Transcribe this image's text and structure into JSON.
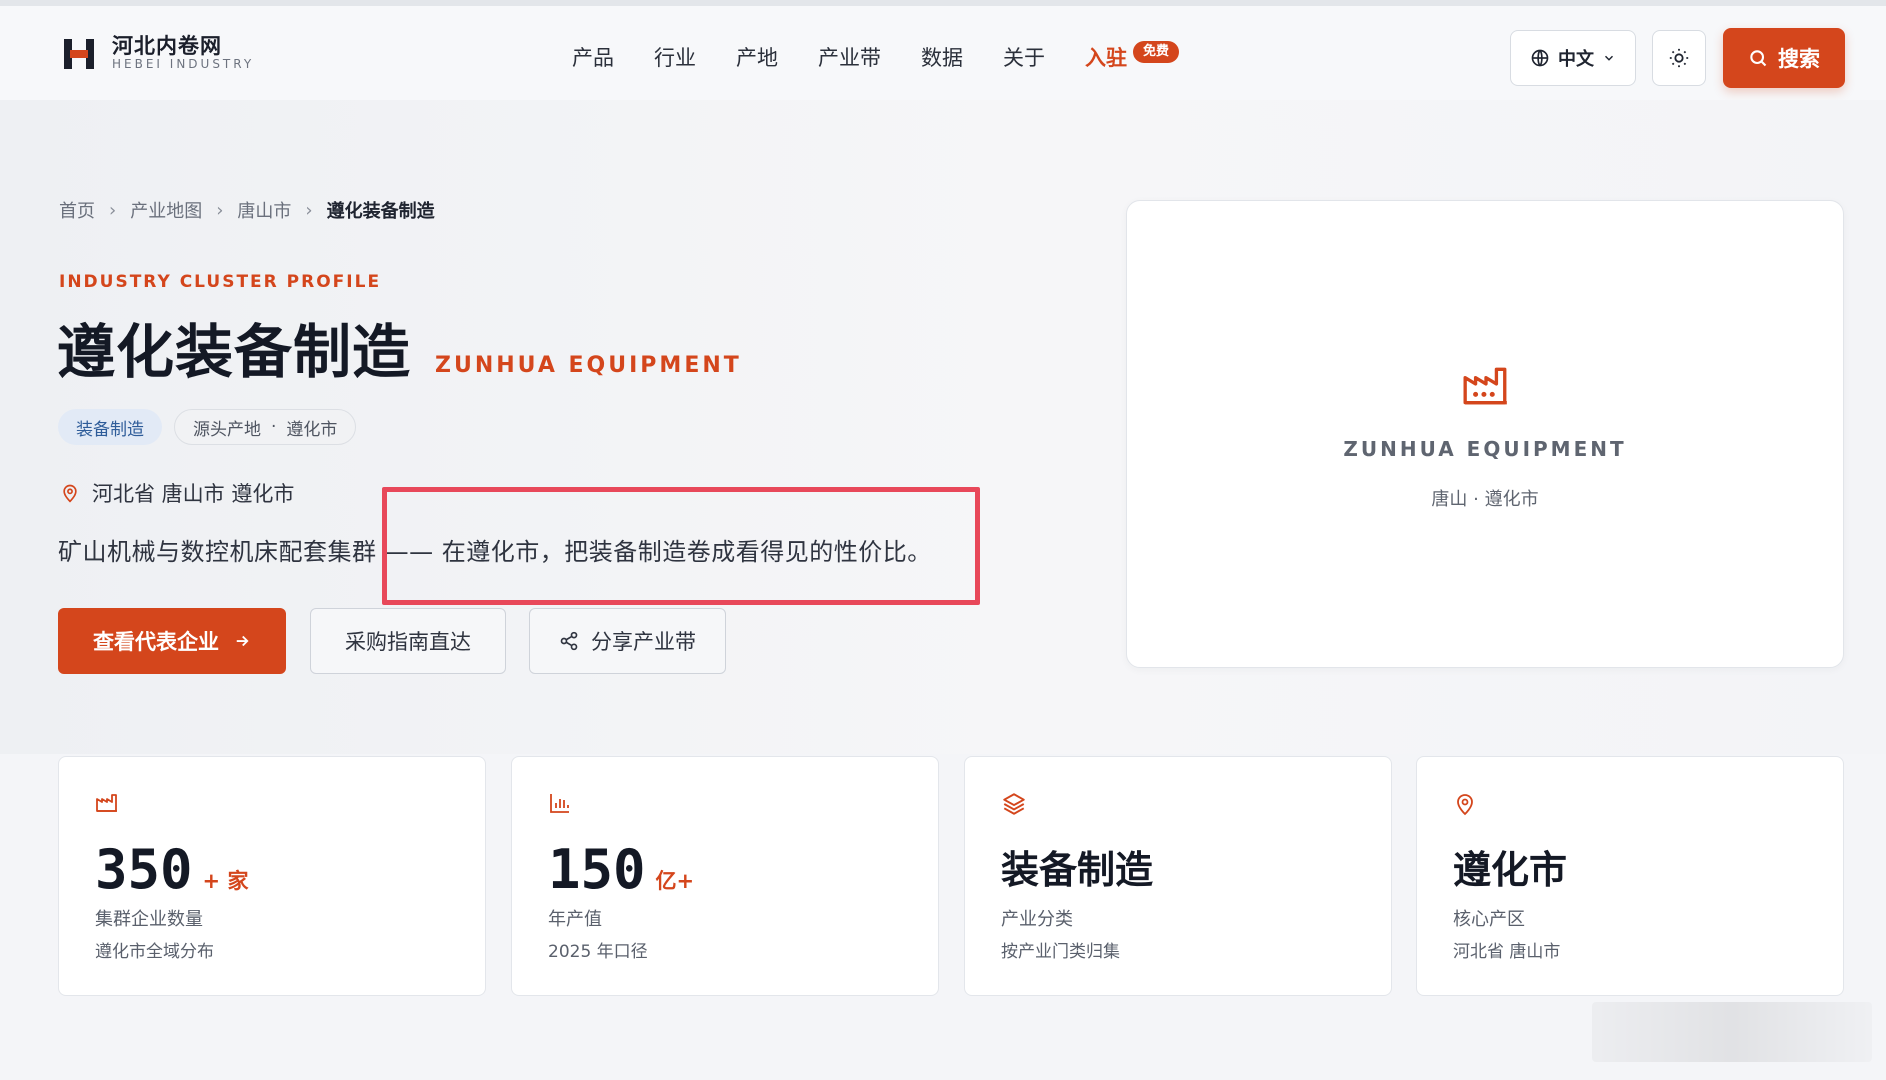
{
  "brand": {
    "name_cn": "河北内卷网",
    "name_en": "HEBEI INDUSTRY"
  },
  "nav": {
    "items": [
      "产品",
      "行业",
      "产地",
      "产业带",
      "数据",
      "关于"
    ],
    "join_label": "入驻",
    "join_badge": "免费"
  },
  "header": {
    "language_label": "中文",
    "search_label": "搜索"
  },
  "breadcrumb": [
    "首页",
    "产业地图",
    "唐山市",
    "遵化装备制造"
  ],
  "hero": {
    "eyebrow": "INDUSTRY CLUSTER PROFILE",
    "title_cn": "遵化装备制造",
    "title_en": "ZUNHUA EQUIPMENT",
    "tag_category": "装备制造",
    "tag_origin_a": "源头产地",
    "tag_origin_b": "遵化市",
    "location": "河北省 唐山市 遵化市",
    "description": "矿山机械与数控机床配套集群 —— 在遵化市，把装备制造卷成看得见的性价比。",
    "btn_primary": "查看代表企业",
    "btn_guide": "采购指南直达",
    "btn_share": "分享产业带",
    "card_en": "ZUNHUA EQUIPMENT",
    "card_loc_a": "唐山",
    "card_loc_b": "遵化市"
  },
  "stats": [
    {
      "icon": "factory-icon",
      "number": "350",
      "unit": "+ 家",
      "label": "集群企业数量",
      "sub": "遵化市全域分布"
    },
    {
      "icon": "bar-chart-icon",
      "number": "150",
      "unit": "亿+",
      "label": "年产值",
      "sub": "2025 年口径"
    },
    {
      "icon": "layers-icon",
      "word": "装备制造",
      "label": "产业分类",
      "sub": "按产业门类归集"
    },
    {
      "icon": "map-pin-icon",
      "word": "遵化市",
      "label": "核心产区",
      "sub": "河北省 唐山市"
    }
  ],
  "colors": {
    "accent": "#d4461c",
    "highlight": "#e8485a",
    "tag_blue": "#2e5c99"
  }
}
